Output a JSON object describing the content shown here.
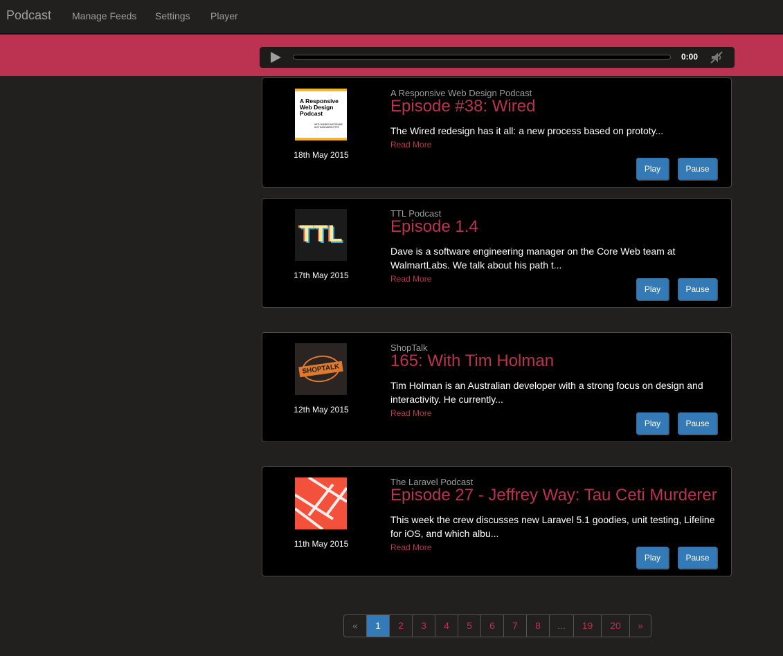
{
  "navbar": {
    "brand": "Podcast",
    "links": [
      "Manage Feeds",
      "Settings",
      "Player"
    ]
  },
  "player": {
    "time": "0:00",
    "progress_fraction": 0
  },
  "episodes": [
    {
      "feed": "A Responsive Web Design Podcast",
      "title": "Episode #38: Wired",
      "description": "The Wired redesign has it all: a new process based on prototy...",
      "date": "18th May 2015",
      "read_more": "Read More",
      "play": "Play",
      "pause": "Pause",
      "art": {
        "line1": "A Responsive",
        "line2": "Web Design",
        "line3": "Podcast",
        "small1": "WITH KAREN MCGRANE",
        "small2": "& ETHAN MARCOTTE"
      }
    },
    {
      "feed": "TTL Podcast",
      "title": "Episode 1.4",
      "description": "Dave is a software engineering manager on the Core Web team at WalmartLabs. We talk about his path t...",
      "date": "17th May 2015",
      "read_more": "Read More",
      "play": "Play",
      "pause": "Pause",
      "art": {
        "text": "TTL"
      }
    },
    {
      "feed": "ShopTalk",
      "title": "165: With Tim Holman",
      "description": "Tim Holman is an Australian developer with a strong focus on design and interactivity. He currently...",
      "date": "12th May 2015",
      "read_more": "Read More",
      "play": "Play",
      "pause": "Pause",
      "art": {
        "text": "SHOPTALK"
      }
    },
    {
      "feed": "The Laravel Podcast",
      "title": "Episode 27 - Jeffrey Way: Tau Ceti Murderer",
      "description": "This week the crew discusses new Laravel 5.1 goodies, unit testing, Lifeline for iOS, and which albu...",
      "date": "11th May 2015",
      "read_more": "Read More",
      "play": "Play",
      "pause": "Pause",
      "art": {}
    }
  ],
  "pagination": {
    "prev": "«",
    "pages": [
      "1",
      "2",
      "3",
      "4",
      "5",
      "6",
      "7",
      "8",
      "...",
      "19",
      "20"
    ],
    "next": "»",
    "active": "1"
  },
  "colors": {
    "accent": "#bb3350",
    "primary_button": "#337ab7",
    "background": "#221f1f"
  },
  "icons": [
    "play-icon",
    "mute-icon"
  ]
}
